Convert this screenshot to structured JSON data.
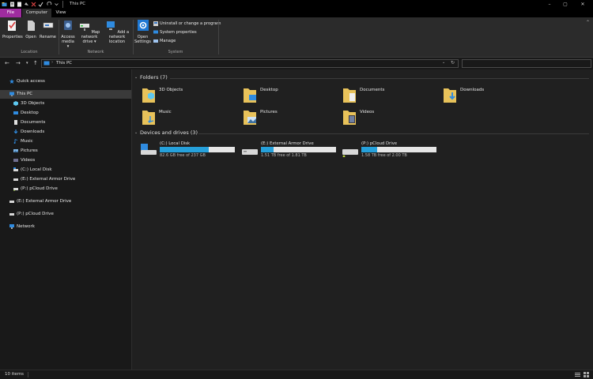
{
  "window": {
    "title": "This PC",
    "minimize": "–",
    "maximize": "▢",
    "close": "✕"
  },
  "tabs": {
    "file": "File",
    "computer": "Computer",
    "view": "View"
  },
  "ribbon": {
    "properties": "Properties",
    "open": "Open",
    "rename": "Rename",
    "access_media": "Access media",
    "map_network_drive": "Map network drive",
    "add_network_location": "Add a network location",
    "open_settings": "Open Settings",
    "uninstall": "Uninstall or change a program",
    "system_properties": "System properties",
    "manage": "Manage",
    "group_location": "Location",
    "group_network": "Network",
    "group_system": "System"
  },
  "address": {
    "path": "This PC"
  },
  "nav": {
    "quick_access": "Quick access",
    "this_pc": "This PC",
    "objects3d": "3D Objects",
    "desktop": "Desktop",
    "documents": "Documents",
    "downloads": "Downloads",
    "music": "Music",
    "pictures": "Pictures",
    "videos": "Videos",
    "local_disk": "(C:) Local Disk",
    "external_armor": "(E:) External Armor Drive",
    "pcloud": "(P:) pCloud Drive",
    "external_armor_root": "(E:) External Armor Drive",
    "pcloud_root": "(P:) pCloud Drive",
    "network": "Network"
  },
  "content": {
    "folders_header": "Folders (7)",
    "drives_header": "Devices and drives (3)",
    "folders": {
      "objects3d": "3D Objects",
      "desktop": "Desktop",
      "documents": "Documents",
      "downloads": "Downloads",
      "music": "Music",
      "pictures": "Pictures",
      "videos": "Videos"
    },
    "drives": {
      "c": {
        "name": "(C:) Local Disk",
        "free": "82.6 GB free of 237 GB",
        "used_fraction": 0.65
      },
      "e": {
        "name": "(E:) External Armor Drive",
        "free": "1.51 TB free of 1.81 TB",
        "used_fraction": 0.17
      },
      "p": {
        "name": "(P:) pCloud Drive",
        "free": "1.58 TB free of 2.00 TB",
        "used_fraction": 0.21
      }
    }
  },
  "status": {
    "items": "10 items"
  },
  "colors": {
    "accent": "#26a0da",
    "file_tab": "#9f2c9f",
    "folder": "#e8c25a",
    "background": "#191919"
  },
  "icons": [
    "folder-icon",
    "drive-icon",
    "computer-icon",
    "star-icon",
    "network-icon",
    "gear-icon"
  ]
}
